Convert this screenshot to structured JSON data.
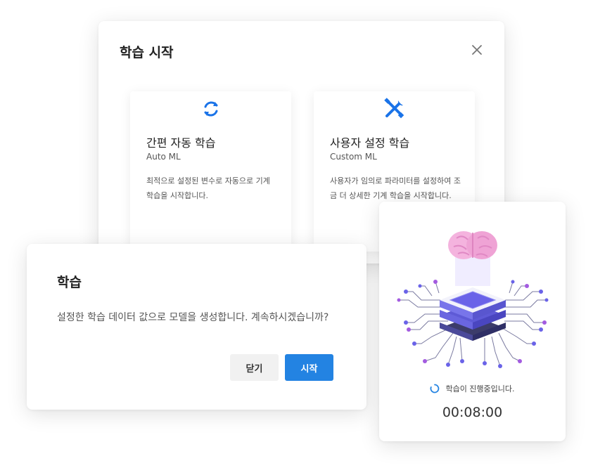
{
  "start_dialog": {
    "title": "학습 시작",
    "options": [
      {
        "title": "간편 자동 학습",
        "subtitle": "Auto ML",
        "description": "최적으로 설정된 변수로 자동으로 기계 학습을 시작합니다.",
        "icon": "refresh-icon"
      },
      {
        "title": "사용자 설정 학습",
        "subtitle": "Custom ML",
        "description": "사용자가 임의로 파라미터를 설정하여 조금 더 상세한 기계 학습을 시작합니다.",
        "icon": "tools-icon"
      }
    ],
    "close_icon": "close-icon"
  },
  "confirm_dialog": {
    "title": "학습",
    "message": "설정한 학습 데이터 값으로 모델을 생성합니다. 계속하시겠습니까?",
    "close_label": "닫기",
    "start_label": "시작"
  },
  "progress": {
    "status_text": "학습이 진행중입니다.",
    "elapsed": "00:08:00",
    "illustration": "ai-brain-chip-illustration"
  },
  "colors": {
    "accent": "#2383e2",
    "icon_blue": "#1a73e8",
    "chip_purple": "#6a63e8",
    "brain_pink": "#f2a6d8"
  }
}
